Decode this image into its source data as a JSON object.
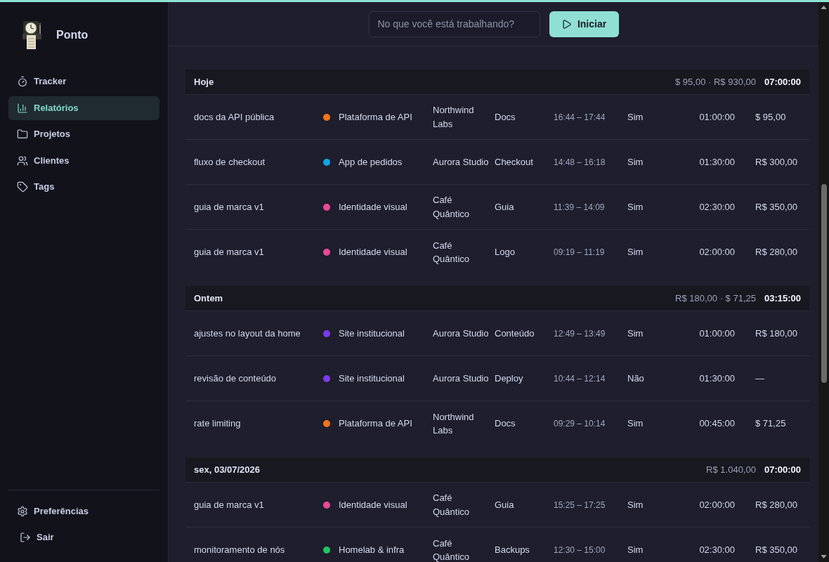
{
  "app": {
    "name": "Ponto"
  },
  "sidebar": {
    "items": [
      {
        "label": "Tracker",
        "selected": false
      },
      {
        "label": "Relatórios",
        "selected": true
      },
      {
        "label": "Projetos",
        "selected": false
      },
      {
        "label": "Clientes",
        "selected": false
      },
      {
        "label": "Tags",
        "selected": false
      }
    ],
    "footer_items": [
      {
        "label": "Preferências"
      },
      {
        "label": "Sair"
      }
    ]
  },
  "timer": {
    "placeholder": "No que você está trabalhando?",
    "button": "Iniciar"
  },
  "groups": [
    {
      "title": "Hoje",
      "amounts": "$ 95,00 · R$ 930,00",
      "total": "07:00:00",
      "entries": [
        {
          "description": "docs da API pública",
          "project": "Plataforma de API",
          "color": "#f97316",
          "client": "Northwind Labs",
          "tag": "Docs",
          "time_range": "16:44 – 17:44",
          "billable": "Sim",
          "duration": "01:00:00",
          "amount": "$ 95,00"
        },
        {
          "description": "fluxo de checkout",
          "project": "App de pedidos",
          "color": "#0ea5e9",
          "client": "Aurora Studio",
          "tag": "Checkout",
          "time_range": "14:48 – 16:18",
          "billable": "Sim",
          "duration": "01:30:00",
          "amount": "R$ 300,00"
        },
        {
          "description": "guia de marca v1",
          "project": "Identidade visual",
          "color": "#ec4899",
          "client": "Café Quântico",
          "tag": "Guia",
          "time_range": "11:39 – 14:09",
          "billable": "Sim",
          "duration": "02:30:00",
          "amount": "R$ 350,00"
        },
        {
          "description": "guia de marca v1",
          "project": "Identidade visual",
          "color": "#ec4899",
          "client": "Café Quântico",
          "tag": "Logo",
          "time_range": "09:19 – 11:19",
          "billable": "Sim",
          "duration": "02:00:00",
          "amount": "R$ 280,00"
        }
      ]
    },
    {
      "title": "Ontem",
      "amounts": "R$ 180,00 · $ 71,25",
      "total": "03:15:00",
      "entries": [
        {
          "description": "ajustes no layout da home",
          "project": "Site institucional",
          "color": "#7c3aed",
          "client": "Aurora Studio",
          "tag": "Conteúdo",
          "time_range": "12:49 – 13:49",
          "billable": "Sim",
          "duration": "01:00:00",
          "amount": "R$ 180,00"
        },
        {
          "description": "revisão de conteúdo",
          "project": "Site institucional",
          "color": "#7c3aed",
          "client": "Aurora Studio",
          "tag": "Deploy",
          "time_range": "10:44 – 12:14",
          "billable": "Não",
          "duration": "01:30:00",
          "amount": "—"
        },
        {
          "description": "rate limiting",
          "project": "Plataforma de API",
          "color": "#f97316",
          "client": "Northwind Labs",
          "tag": "Docs",
          "time_range": "09:29 – 10:14",
          "billable": "Sim",
          "duration": "00:45:00",
          "amount": "$ 71,25"
        }
      ]
    },
    {
      "title": "sex, 03/07/2026",
      "amounts": "R$ 1.040,00",
      "total": "07:00:00",
      "entries": [
        {
          "description": "guia de marca v1",
          "project": "Identidade visual",
          "color": "#ec4899",
          "client": "Café Quântico",
          "tag": "Guia",
          "time_range": "15:25 – 17:25",
          "billable": "Sim",
          "duration": "02:00:00",
          "amount": "R$ 280,00"
        },
        {
          "description": "monitoramento de nós",
          "project": "Homelab & infra",
          "color": "#22c55e",
          "client": "Café Quântico",
          "tag": "Backups",
          "time_range": "12:30 – 15:00",
          "billable": "Sim",
          "duration": "02:30:00",
          "amount": "R$ 350,00"
        }
      ]
    }
  ]
}
